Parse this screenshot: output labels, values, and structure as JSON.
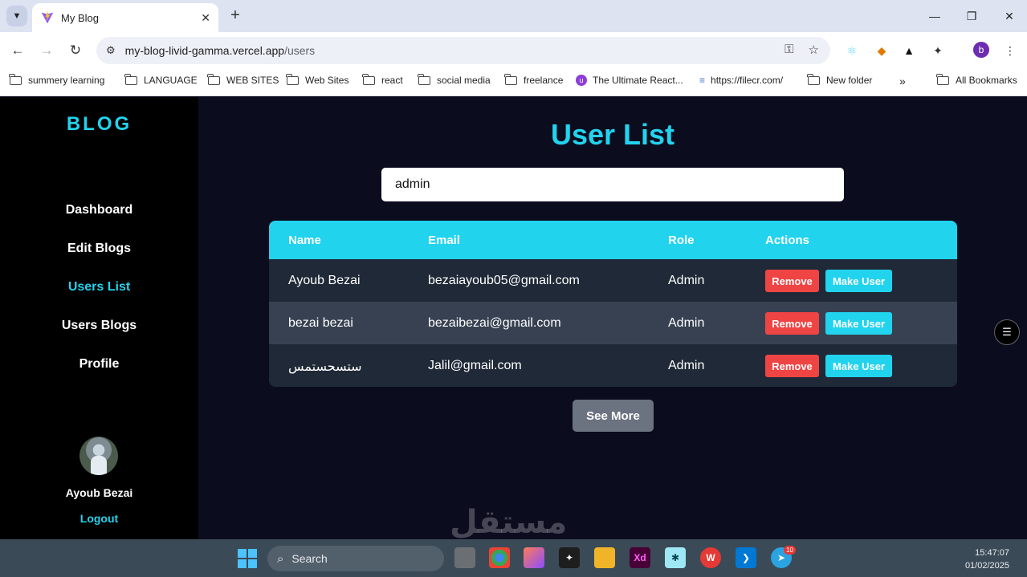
{
  "browser": {
    "tab_title": "My Blog",
    "url_host": "my-blog-livid-gamma.vercel.app",
    "url_path": "/users",
    "profile_initial": "b",
    "bookmarks": [
      "summery learning",
      "LANGUAGE",
      "WEB SITES",
      "Web Sites",
      "react",
      "social media",
      "freelance",
      "The Ultimate React...",
      "https://filecr.com/",
      "New folder"
    ],
    "all_bookmarks": "All Bookmarks"
  },
  "sidebar": {
    "brand": "BLOG",
    "items": [
      {
        "label": "Dashboard"
      },
      {
        "label": "Edit Blogs"
      },
      {
        "label": "Users List"
      },
      {
        "label": "Users Blogs"
      },
      {
        "label": "Profile"
      }
    ],
    "active_index": 2,
    "user_name": "Ayoub Bezai",
    "logout": "Logout"
  },
  "main": {
    "title": "User List",
    "search_value": "admin",
    "columns": [
      "Name",
      "Email",
      "Role",
      "Actions"
    ],
    "rows": [
      {
        "name": "Ayoub Bezai",
        "email": "bezaiayoub05@gmail.com",
        "role": "Admin"
      },
      {
        "name": "bezai bezai",
        "email": "bezaibezai@gmail.com",
        "role": "Admin"
      },
      {
        "name": "ستسحستمس",
        "email": "Jalil@gmail.com",
        "role": "Admin"
      }
    ],
    "remove_label": "Remove",
    "make_user_label": "Make User",
    "see_more": "See More"
  },
  "taskbar": {
    "search_label": "Search",
    "time": "15:47:07",
    "date": "01/02/2025",
    "telegram_badge": "10"
  },
  "colors": {
    "accent": "#22d3ee",
    "danger": "#ef4444",
    "sidebar_bg": "#000000",
    "main_bg": "#0b0c1e"
  }
}
